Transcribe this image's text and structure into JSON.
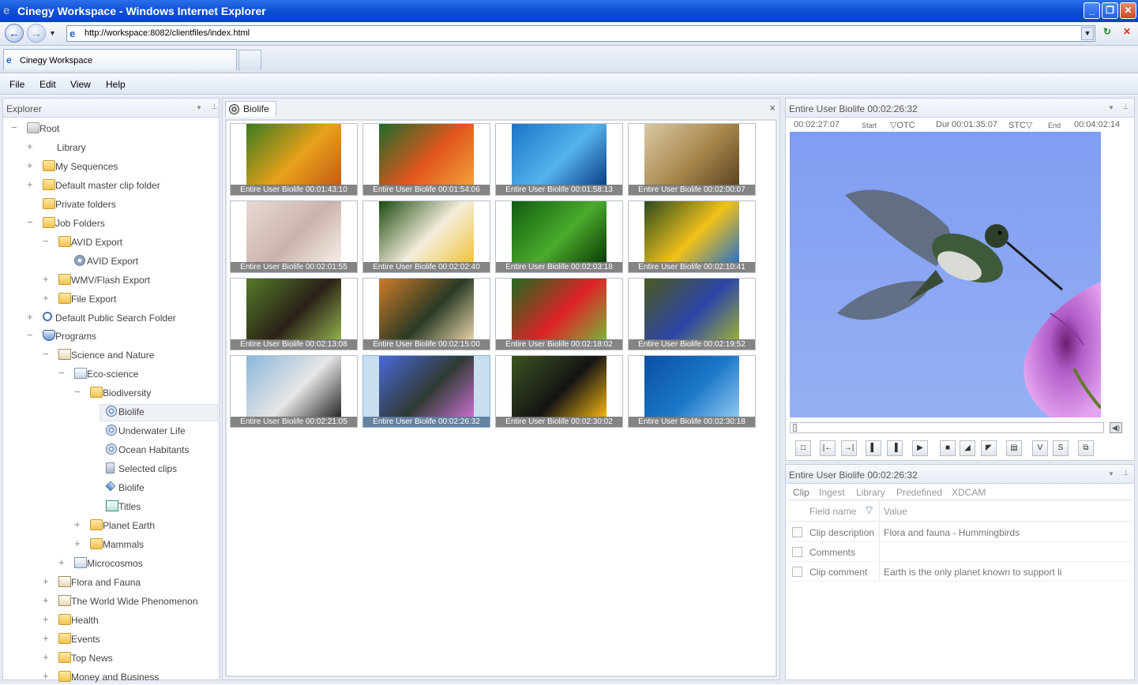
{
  "window": {
    "title": "Cinegy Workspace - Windows Internet Explorer"
  },
  "browser": {
    "url": "http://workspace:8082/clientfiles/index.html",
    "tab_label": "Cinegy Workspace"
  },
  "menu": [
    "File",
    "Edit",
    "View",
    "Help"
  ],
  "explorer": {
    "title": "Explorer",
    "items": [
      {
        "label": "Root",
        "level": 0,
        "expander": "−",
        "icon": "root"
      },
      {
        "label": "Library",
        "level": 1,
        "expander": "+",
        "icon": "none"
      },
      {
        "label": "My Sequences",
        "level": 1,
        "expander": "+",
        "icon": "folder"
      },
      {
        "label": "Default master clip folder",
        "level": 1,
        "expander": "+",
        "icon": "folder"
      },
      {
        "label": "Private folders",
        "level": 1,
        "expander": "",
        "icon": "folder"
      },
      {
        "label": "Job Folders",
        "level": 1,
        "expander": "−",
        "icon": "folder"
      },
      {
        "label": "AVID Export",
        "level": 2,
        "expander": "−",
        "icon": "folder"
      },
      {
        "label": "AVID Export",
        "level": 3,
        "expander": "",
        "icon": "gear"
      },
      {
        "label": "WMV/Flash Export",
        "level": 2,
        "expander": "+",
        "icon": "folder"
      },
      {
        "label": "File Export",
        "level": 2,
        "expander": "+",
        "icon": "folder"
      },
      {
        "label": "Default Public Search Folder",
        "level": 1,
        "expander": "+",
        "icon": "search"
      },
      {
        "label": "Programs",
        "level": 1,
        "expander": "−",
        "icon": "programs"
      },
      {
        "label": "Science and Nature",
        "level": 2,
        "expander": "−",
        "icon": "program"
      },
      {
        "label": "Eco-science",
        "level": 3,
        "expander": "−",
        "icon": "series"
      },
      {
        "label": "Biodiversity",
        "level": 4,
        "expander": "−",
        "icon": "folder"
      },
      {
        "label": "Biolife",
        "level": 5,
        "expander": "",
        "icon": "reel",
        "selected": true
      },
      {
        "label": "Underwater Life",
        "level": 5,
        "expander": "",
        "icon": "reel"
      },
      {
        "label": "Ocean Habitants",
        "level": 5,
        "expander": "",
        "icon": "reel"
      },
      {
        "label": "Selected clips",
        "level": 5,
        "expander": "",
        "icon": "clips"
      },
      {
        "label": "Biolife",
        "level": 5,
        "expander": "",
        "icon": "diamond"
      },
      {
        "label": "Titles",
        "level": 5,
        "expander": "",
        "icon": "titles"
      },
      {
        "label": "Planet Earth",
        "level": 4,
        "expander": "+",
        "icon": "folder"
      },
      {
        "label": "Mammals",
        "level": 4,
        "expander": "+",
        "icon": "folder"
      },
      {
        "label": "Microcosmos",
        "level": 3,
        "expander": "+",
        "icon": "series"
      },
      {
        "label": "Flora and Fauna",
        "level": 2,
        "expander": "+",
        "icon": "program"
      },
      {
        "label": "The World Wide Phenomenon",
        "level": 2,
        "expander": "+",
        "icon": "program"
      },
      {
        "label": "Health",
        "level": 2,
        "expander": "+",
        "icon": "folder"
      },
      {
        "label": "Events",
        "level": 2,
        "expander": "+",
        "icon": "folder"
      },
      {
        "label": "Top News",
        "level": 2,
        "expander": "+",
        "icon": "folder"
      },
      {
        "label": "Money and Business",
        "level": 2,
        "expander": "+",
        "icon": "folder"
      }
    ]
  },
  "clips_panel": {
    "tab_label": "Biolife",
    "close_glyph": "×",
    "clips": [
      {
        "caption": "Entire User Biolife 00:01:43:10",
        "subject": "butterflies",
        "colors": [
          "#3c7a1d",
          "#e8a21c",
          "#c45a12"
        ]
      },
      {
        "caption": "Entire User Biolife 00:01:54:06",
        "subject": "bee on flower",
        "colors": [
          "#1f6b2a",
          "#e2561d",
          "#f3a13b"
        ]
      },
      {
        "caption": "Entire User Biolife 00:01:58:13",
        "subject": "dolphins",
        "colors": [
          "#1d74c8",
          "#55b2ea",
          "#0b3f86"
        ]
      },
      {
        "caption": "Entire User Biolife 00:02:00:07",
        "subject": "giraffe",
        "colors": [
          "#d9c8a4",
          "#a8864a",
          "#5a4423"
        ]
      },
      {
        "caption": "Entire User Biolife 00:02:01:55",
        "subject": "polar bear",
        "colors": [
          "#e8d9d5",
          "#cbb3ac",
          "#f6efe9"
        ]
      },
      {
        "caption": "Entire User Biolife 00:02:02:40",
        "subject": "frangipani",
        "colors": [
          "#1c4a10",
          "#f4eedc",
          "#f0c43a"
        ]
      },
      {
        "caption": "Entire User Biolife 00:02:03:18",
        "subject": "green leaves",
        "colors": [
          "#0f5d10",
          "#4bab2c",
          "#0a3a07"
        ]
      },
      {
        "caption": "Entire User Biolife 00:02:10:41",
        "subject": "macaws",
        "colors": [
          "#2d4a1f",
          "#f1c21b",
          "#2a71c5"
        ]
      },
      {
        "caption": "Entire User Biolife 00:02:13:08",
        "subject": "chimpanzee",
        "colors": [
          "#557a2a",
          "#2a2217",
          "#93b04b"
        ]
      },
      {
        "caption": "Entire User Biolife 00:02:15:00",
        "subject": "tiger",
        "colors": [
          "#cc7c2a",
          "#2b3a24",
          "#e5d3a8"
        ]
      },
      {
        "caption": "Entire User Biolife 00:02:18:02",
        "subject": "hibiscus",
        "colors": [
          "#1f6a1c",
          "#de2226",
          "#7ab43a"
        ]
      },
      {
        "caption": "Entire User Biolife 00:02:19:52",
        "subject": "blue macaw",
        "colors": [
          "#4c5a1f",
          "#2c45a8",
          "#9cae3a"
        ]
      },
      {
        "caption": "Entire User Biolife 00:02:21:05",
        "subject": "penguins",
        "colors": [
          "#8ab6dd",
          "#e6e6e6",
          "#262626"
        ]
      },
      {
        "caption": "Entire User Biolife 00:02:26:32",
        "subject": "hummingbird",
        "colors": [
          "#4a6ad8",
          "#2f3a34",
          "#c86fd0"
        ],
        "selected": true
      },
      {
        "caption": "Entire User Biolife 00:02:30:02",
        "subject": "toucan",
        "colors": [
          "#3c5420",
          "#141414",
          "#f3b612"
        ]
      },
      {
        "caption": "Entire User Biolife 00:02:30:18",
        "subject": "whale",
        "colors": [
          "#0b4fa3",
          "#1c78c8",
          "#8fc8f0"
        ]
      }
    ]
  },
  "preview": {
    "title": "Entire User Biolife 00:02:26:32",
    "timecode_current": "00:02:27:07",
    "start_label": "Start",
    "votc_label": "▽OTC",
    "dur_label": "Dur",
    "duration": "00:01:35:07",
    "stc_label": "STC▽",
    "end_label": "End",
    "end_tc": "00:04:02:14",
    "buttons": [
      "□",
      "|←",
      "→|",
      "▌",
      "▐",
      "▶",
      "■",
      "◢",
      "◤",
      "▤",
      "V",
      "S",
      "⧉"
    ]
  },
  "metadata": {
    "title": "Entire User Biolife 00:02:26:32",
    "tabs": [
      "Clip",
      "Ingest",
      "Library",
      "Predefined",
      "XDCAM"
    ],
    "columns": [
      "Field name",
      "Value"
    ],
    "rows": [
      {
        "field": "Clip description",
        "value": "Flora and fauna - Hummingbirds"
      },
      {
        "field": "Comments",
        "value": ""
      },
      {
        "field": "Clip comment",
        "value": "Earth is the only planet known to support li"
      }
    ]
  }
}
